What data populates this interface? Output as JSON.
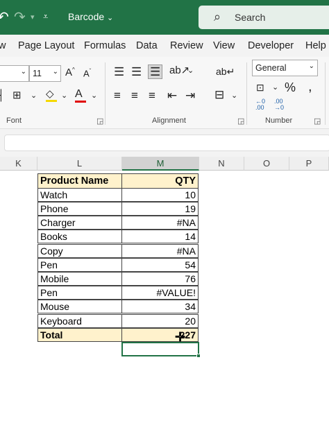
{
  "titlebar": {
    "filename": "Barcode",
    "search_label": "Search"
  },
  "menu": {
    "tabs": [
      "w",
      "Page Layout",
      "Formulas",
      "Data",
      "Review",
      "View",
      "Developer",
      "Help"
    ]
  },
  "ribbon": {
    "font_size": "11",
    "number_format": "General",
    "groups": {
      "font": "Font",
      "alignment": "Alignment",
      "number": "Number"
    }
  },
  "columns": [
    "K",
    "L",
    "M",
    "N",
    "O",
    "P"
  ],
  "table": {
    "headers": [
      "Product Name",
      "QTY"
    ],
    "rows": [
      [
        "Watch",
        "10"
      ],
      [
        "Phone",
        "19"
      ],
      [
        "Charger",
        "#NA"
      ],
      [
        "Books",
        "14"
      ],
      [
        "Copy",
        "#NA"
      ],
      [
        "Pen",
        "54"
      ],
      [
        "Mobile",
        "76"
      ],
      [
        "Pen",
        "#VALUE!"
      ],
      [
        "Mouse",
        "34"
      ],
      [
        "Keyboard",
        "20"
      ]
    ],
    "total_label": "Total",
    "total_value": "227"
  },
  "colors": {
    "excel_green": "#217346",
    "header_fill": "#fff2cc"
  }
}
